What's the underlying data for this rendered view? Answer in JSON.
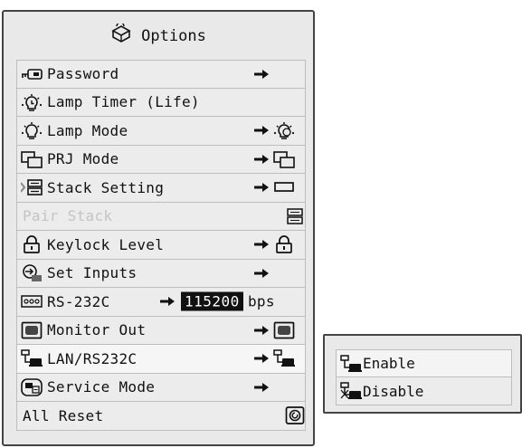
{
  "menu": {
    "title": "Options",
    "title_icon": "options-icon",
    "items": [
      {
        "label": "Password",
        "icon": "password-key-icon",
        "arrow": true
      },
      {
        "label": "Lamp Timer (Life)",
        "icon": "lamp-timer-icon",
        "arrow": false
      },
      {
        "label": "Lamp Mode",
        "icon": "lamp-mode-icon",
        "arrow": true,
        "right_icon": "lamp-mode-value-icon"
      },
      {
        "label": "PRJ Mode",
        "icon": "prj-mode-icon",
        "arrow": true,
        "right_icon": "prj-mode-value-icon"
      },
      {
        "label": "Stack Setting",
        "icon": "stack-setting-icon",
        "arrow": true,
        "right_icon": "stack-value-icon"
      },
      {
        "label": "Pair Stack",
        "disabled": true,
        "right_icon": "pair-stack-icon"
      },
      {
        "label": "Keylock Level",
        "icon": "keylock-icon",
        "arrow": true,
        "right_icon": "keylock-value-icon"
      },
      {
        "label": "Set Inputs",
        "icon": "set-inputs-icon",
        "arrow": true
      },
      {
        "label": "RS-232C",
        "icon": "rs232c-icon",
        "arrow": true,
        "value": "115200",
        "unit": "bps"
      },
      {
        "label": "Monitor Out",
        "icon": "monitor-out-icon",
        "arrow": true,
        "right_icon": "monitor-out-value-icon"
      },
      {
        "label": "LAN/RS232C",
        "icon": "lan-icon",
        "arrow": true,
        "right_icon": "lan-value-icon",
        "selected": true
      },
      {
        "label": "Service Mode",
        "icon": "service-mode-icon",
        "arrow": true
      },
      {
        "label": "All Reset",
        "right_icon": "reset-icon"
      }
    ]
  },
  "submenu": {
    "items": [
      {
        "label": "Enable",
        "icon": "lan-enable-icon",
        "selected": true
      },
      {
        "label": "Disable",
        "icon": "lan-disable-icon"
      }
    ]
  },
  "colors": {
    "panel_bg": "#e9e9e9",
    "border": "#444444",
    "highlight": "#f6f6f6",
    "disabled_text": "#c4c4c4",
    "value_bg": "#111111"
  }
}
